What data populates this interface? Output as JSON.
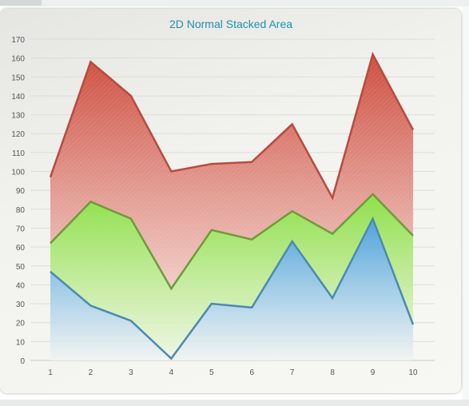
{
  "chart_data": {
    "type": "area",
    "stacked": true,
    "title": "2D Normal Stacked Area",
    "categories": [
      "1",
      "2",
      "3",
      "4",
      "5",
      "6",
      "7",
      "8",
      "9",
      "10"
    ],
    "series": [
      {
        "values": [
          47,
          29,
          21,
          1,
          30,
          28,
          63,
          33,
          75,
          19
        ],
        "color": "#4b8ab0"
      },
      {
        "values": [
          15,
          55,
          54,
          37,
          39,
          36,
          16,
          34,
          13,
          47
        ],
        "color": "#6f9a3c"
      },
      {
        "values": [
          35,
          74,
          65,
          62,
          35,
          41,
          46,
          19,
          74,
          56
        ],
        "color": "#b84a3e"
      }
    ],
    "ylim": [
      0,
      170
    ],
    "yticks": [
      "0",
      "10",
      "20",
      "30",
      "40",
      "50",
      "60",
      "70",
      "80",
      "90",
      "100",
      "110",
      "120",
      "130",
      "140",
      "150",
      "160",
      "170"
    ],
    "grid": true,
    "legend": "none",
    "title_color": "#1e8fb0",
    "tick_color": "#555555"
  }
}
